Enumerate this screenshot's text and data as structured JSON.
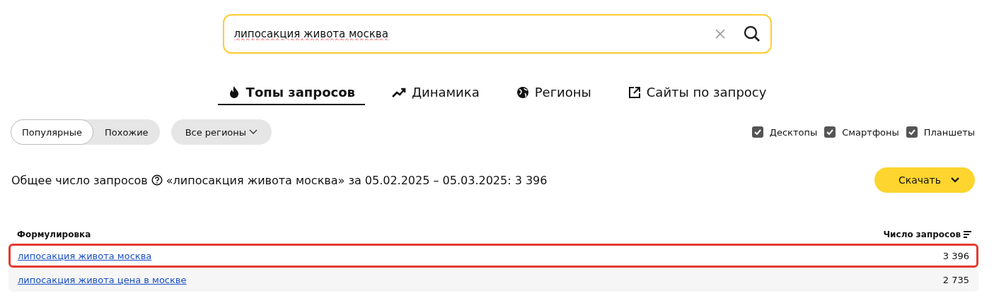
{
  "search": {
    "value": "липосакция живота москва"
  },
  "tabs": [
    {
      "label": "Топы запросов",
      "kind": "flame",
      "selected": true
    },
    {
      "label": "Динамика",
      "kind": "trend",
      "selected": false
    },
    {
      "label": "Регионы",
      "kind": "globe",
      "selected": false
    },
    {
      "label": "Сайты по запросу",
      "kind": "external",
      "selected": false
    }
  ],
  "modes": [
    {
      "label": "Популярные",
      "selected": true
    },
    {
      "label": "Похожие",
      "selected": false
    }
  ],
  "region_button": "Все регионы",
  "devices": [
    {
      "label": "Десктопы",
      "checked": true
    },
    {
      "label": "Смартфоны",
      "checked": true
    },
    {
      "label": "Планшеты",
      "checked": true
    }
  ],
  "summary": {
    "label": "Общее число запросов",
    "text": "«липосакция живота москва» за 05.02.2025 – 05.03.2025: 3 396"
  },
  "download_button": "Скачать",
  "table": {
    "columns": [
      "Формулировка",
      "Число запросов"
    ],
    "rows": [
      {
        "phrase": "липосакция живота москва",
        "count": "3 396",
        "highlighted": true
      },
      {
        "phrase": "липосакция живота цена в москве",
        "count": "2 735",
        "highlighted": false
      }
    ]
  }
}
